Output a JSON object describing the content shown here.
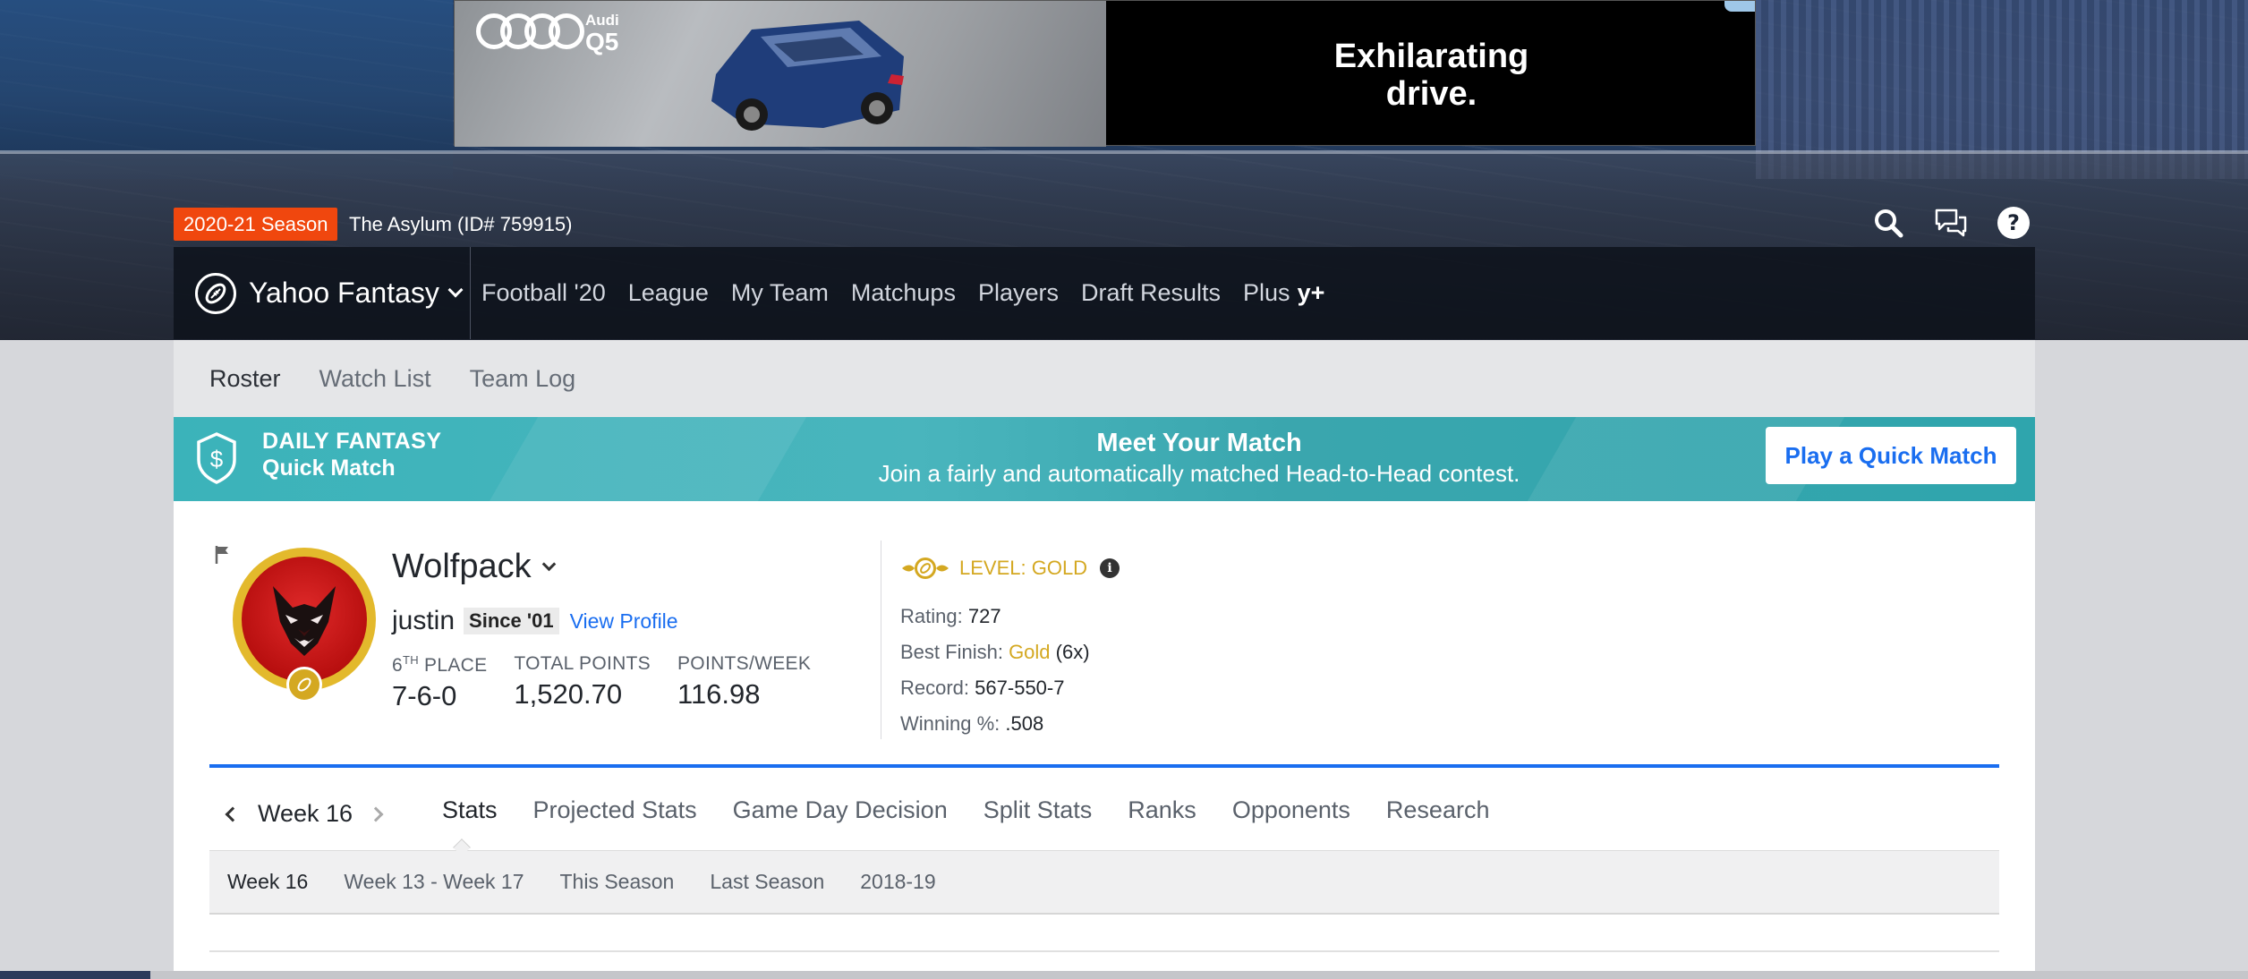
{
  "ad": {
    "brand": "Audi",
    "model": "Q5",
    "tagline": "Exhilarating drive."
  },
  "header": {
    "season_badge": "2020-21 Season",
    "league_name": "The Asylum (ID# 759915)"
  },
  "mainnav": {
    "brand": "Yahoo Fantasy",
    "links": [
      "Football '20",
      "League",
      "My Team",
      "Matchups",
      "Players",
      "Draft Results",
      "Plus"
    ],
    "plus_badge": "y+"
  },
  "subnav": {
    "items": [
      "Roster",
      "Watch List",
      "Team Log"
    ],
    "active": "Roster"
  },
  "promo": {
    "line1": "DAILY FANTASY",
    "line2": "Quick Match",
    "title": "Meet Your Match",
    "subtitle": "Join a fairly and automatically matched Head-to-Head contest.",
    "button": "Play a Quick Match"
  },
  "team": {
    "name": "Wolfpack",
    "owner": "justin",
    "since": "Since '01",
    "view_profile": "View Profile",
    "place_num": "6",
    "place_suffix": "TH",
    "place_label": " PLACE",
    "record": "7-6-0",
    "total_points_label": "TOTAL POINTS",
    "total_points": "1,520.70",
    "ppw_label": "POINTS/WEEK",
    "ppw": "116.98"
  },
  "manager": {
    "level": "LEVEL: GOLD",
    "rating_label": "Rating:",
    "rating": "727",
    "best_finish_label": "Best Finish:",
    "best_finish": "Gold",
    "best_finish_count": "(6x)",
    "record_label": "Record:",
    "record": "567-550-7",
    "winpct_label": "Winning %:",
    "winpct": ".508"
  },
  "statnav": {
    "week": "Week 16",
    "tabs": [
      "Stats",
      "Projected Stats",
      "Game Day Decision",
      "Split Stats",
      "Ranks",
      "Opponents",
      "Research"
    ],
    "active_tab": "Stats"
  },
  "ranges": {
    "items": [
      "Week 16",
      "Week 13 - Week 17",
      "This Season",
      "Last Season",
      "2018-19"
    ],
    "active": "Week 16"
  },
  "colors": {
    "season_badge": "#f0470e",
    "link_blue": "#1a6ef0",
    "gold": "#d4a821",
    "promo_teal": "#3bb3ba"
  }
}
